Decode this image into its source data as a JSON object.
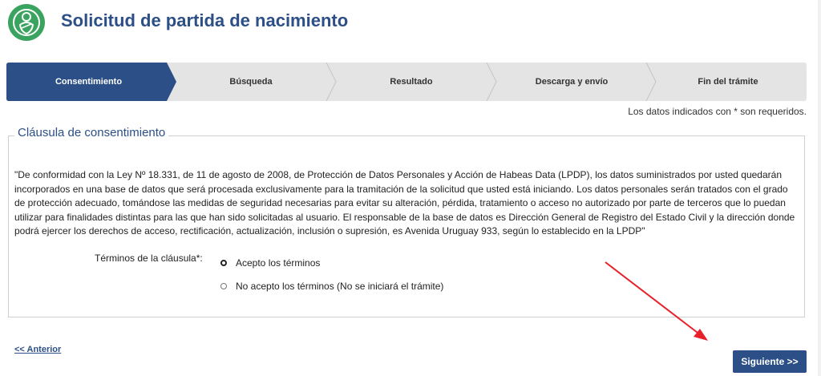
{
  "header": {
    "title": "Solicitud de partida de nacimiento",
    "logo_icon": "baby-swaddle-icon",
    "logo_color": "#3aa35f"
  },
  "stepper": {
    "steps": [
      {
        "label": "Consentimiento",
        "active": true
      },
      {
        "label": "Búsqueda",
        "active": false
      },
      {
        "label": "Resultado",
        "active": false
      },
      {
        "label": "Descarga y envío",
        "active": false
      },
      {
        "label": "Fin del trámite",
        "active": false
      }
    ],
    "active_color": "#2b4f86",
    "inactive_color": "#e4e4e4"
  },
  "required_note": "Los datos indicados con * son requeridos.",
  "clause": {
    "legend": "Cláusula de consentimiento",
    "text": "\"De conformidad con la Ley Nº 18.331, de 11 de agosto de 2008, de Protección de Datos Personales y Acción de Habeas Data (LPDP), los datos suministrados por usted quedarán incorporados en una base de datos que será procesada exclusivamente para la tramitación de la solicitud que usted está iniciando. Los datos personales serán tratados con el grado de protección adecuado, tomándose las medidas de seguridad necesarias para evitar su alteración, pérdida, tratamiento o acceso no autorizado por parte de terceros que lo puedan utilizar para finalidades distintas para las que han sido solicitadas al usuario. El responsable de la base de datos es Dirección General de Registro del Estado Civil y la dirección donde podrá ejercer los derechos de acceso, rectificación, actualización, inclusión o supresión, es Avenida Uruguay 933, según lo establecido en la LPDP\"",
    "terms_label": "Términos de la cláusula*:",
    "options": [
      {
        "label": "Acepto los términos",
        "checked": true
      },
      {
        "label": "No acepto los términos (No se iniciará el trámite)",
        "checked": false
      }
    ]
  },
  "nav": {
    "prev_label": "<< Anterior",
    "next_label": "Siguiente >>"
  },
  "annotation": {
    "arrow_color": "#e8202a"
  }
}
